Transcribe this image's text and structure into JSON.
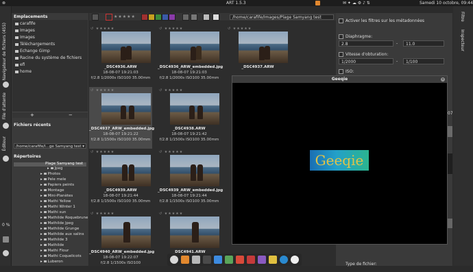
{
  "topbar": {
    "window_title": "ART 1.5.3",
    "datetime": "Samedi 10 octobre, 09:44"
  },
  "left_tabs": {
    "navigator": "Navigateur de fichiers (455)",
    "queue": "File d'attente",
    "editor": "Éditeur",
    "zoom": "0 %"
  },
  "places": {
    "title": "Emplacements",
    "items": [
      "carafife",
      "Images",
      "Images",
      "Téléchargements",
      "Echange Gimp",
      "Racine du système de fichiers",
      "efi",
      "home"
    ]
  },
  "recent": {
    "title": "Fichiers récents",
    "value": "/home/carafife/I...ge Samyang test"
  },
  "directories": {
    "title": "Répertoires",
    "current": "Plage Samyang test",
    "items": [
      "Jpeg",
      "Photos",
      "Pele mele",
      "Papiers peints",
      "Montage",
      "Mini-Planètes",
      "Mathi Yellow",
      "Mathi Winter 1",
      "Mathi sun",
      "Mathilde Roquebrune",
      "Mathilde Jpeg",
      "Mathilde Grunge",
      "Mathilde aux salins",
      "Mathilde 3",
      "Mathilde",
      "Mathi Flour",
      "Mathi Coquelicots",
      "Luberon",
      "Loulou sourcette",
      "Loulou Rail",
      "Loulou 35mm"
    ]
  },
  "browser": {
    "path": "/home/carafife/Images/Plage Samyang test",
    "thumbs": [
      {
        "name": "_DSC4936.ARW",
        "date": "18-08-07 19:21:03",
        "exif": "f/2.8 1/2000s ISO100 35.00mm"
      },
      {
        "name": "_DSC4936_ARW_embedded.jpg",
        "date": "18-08-07 19:21:03",
        "exif": "f/2.8 1/2000s ISO100 35.00mm"
      },
      {
        "name": "_DSC4937.ARW",
        "date": "18-08-07 19:21:22",
        "exif": "f/2.8 1/1500s ISO100 35.00mm"
      },
      {
        "name": "_DSC4937_ARW_embedded.jpg",
        "date": "18-08-07 19:21:22",
        "exif": "f/2.8 1/1500s ISO100 35.00mm"
      },
      {
        "name": "_DSC4938.ARW",
        "date": "18-08-07 19:21:42",
        "exif": "f/2.8 1/1500s ISO100 35.00mm"
      },
      {
        "name": "_DSC4938_ARW_embedded.jpg",
        "date": "18-08-07 19:21:42",
        "exif": "f/2.8 1/1500s ISO100 35.00mm"
      },
      {
        "name": "_DSC4939.ARW",
        "date": "18-08-07 19:21:44",
        "exif": "f/2.8 1/1500s ISO100 35.00mm"
      },
      {
        "name": "_DSC4939_ARW_embedded.jpg",
        "date": "18-08-07 19:21:44",
        "exif": "f/2.8 1/1500s ISO100 35.00mm"
      },
      {
        "name": "_DSC4940_ARW_embedded.jpg",
        "date": "18-08-07 19:22:07",
        "exif": "f/2.8 1/1500s ISO100"
      },
      {
        "name": "_DSC4941.ARW",
        "date": "",
        "exif": ""
      }
    ]
  },
  "filters": {
    "metadata_toggle": "Activer les filtres sur les métadonnées",
    "aperture_label": "Diaphragme:",
    "aperture_min": "2.8",
    "aperture_max": "11.0",
    "shutter_label": "Vitesse d'obturation:",
    "shutter_min": "1/2000",
    "shutter_max": "1/100",
    "iso_label": "ISO:",
    "file_type_label": "Type de fichier:",
    "partial_value": "07"
  },
  "right_tabs": {
    "filter": "Filtre",
    "inspector": "Inspecteur"
  },
  "geeqie": {
    "title": "Geeqie",
    "logo_text": "Geeqie"
  },
  "colors": {
    "accent": "#e2882e",
    "geeqie_logo_text": "#e0c24a"
  }
}
